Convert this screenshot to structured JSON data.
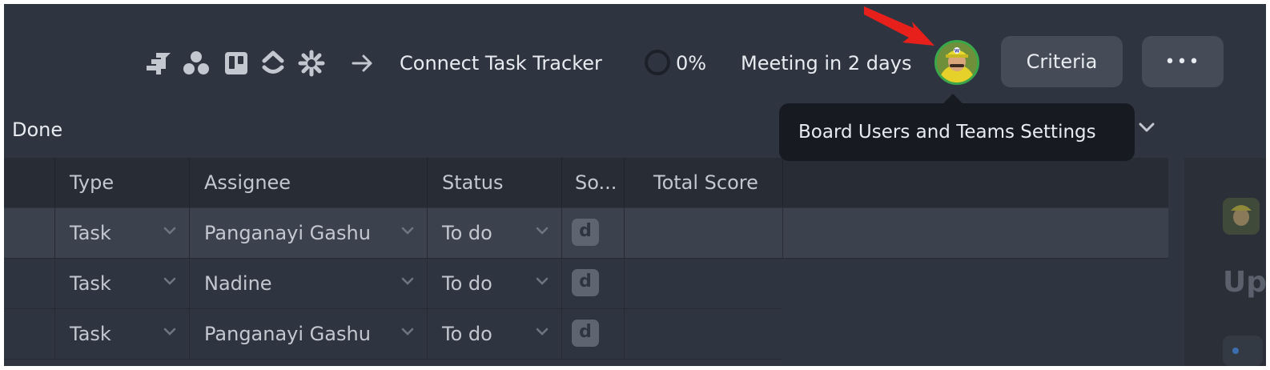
{
  "toolbar": {
    "integration_icons": [
      "jira-icon",
      "asana-icon",
      "trello-icon",
      "clickup-icon",
      "zendesk-icon"
    ],
    "connect_label": "Connect Task Tracker",
    "progress_label": "0%",
    "progress_value": 0,
    "meeting_label": "Meeting in 2 days",
    "criteria_label": "Criteria",
    "more_label": "•••"
  },
  "tooltip": {
    "text": "Board Users and Teams Settings"
  },
  "group": {
    "label": "Done"
  },
  "table": {
    "columns": [
      "Type",
      "Assignee",
      "Status",
      "So...",
      "Total Score"
    ],
    "rows": [
      {
        "type": "Task",
        "assignee": "Panganayi Gashu",
        "status": "To do",
        "score_badge": "d",
        "total": ""
      },
      {
        "type": "Task",
        "assignee": "Nadine",
        "status": "To do",
        "score_badge": "d",
        "total": ""
      },
      {
        "type": "Task",
        "assignee": "Panganayi Gashu",
        "status": "To do",
        "score_badge": "d",
        "total": ""
      }
    ]
  },
  "side_panel": {
    "heading_fragment": "Up"
  },
  "colors": {
    "background": "#2f3540",
    "header_row": "#272c35",
    "highlight_row": "#3b424e",
    "button": "#454c57",
    "tooltip": "#171b21",
    "annotation_arrow": "#e8201c",
    "avatar_ring": "#3aa84a"
  }
}
